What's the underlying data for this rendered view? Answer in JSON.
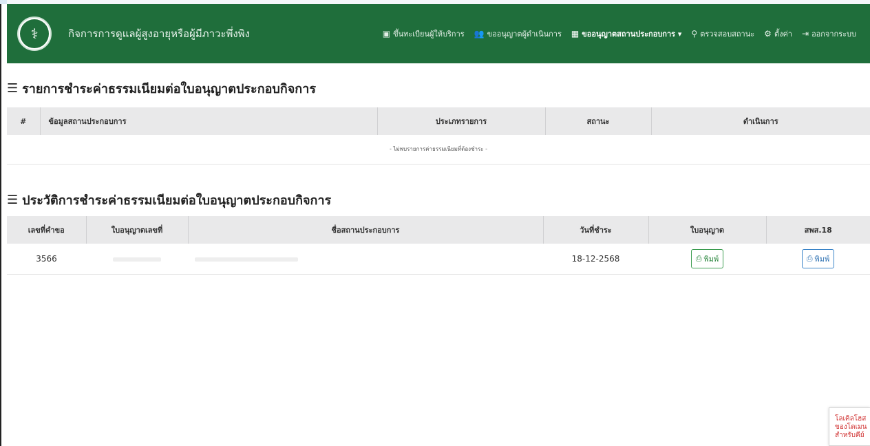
{
  "navbar": {
    "brand": "กิจการการดูแลผู้สูงอายุหรือผู้มีภาวะพึ่งพิง",
    "items": [
      {
        "icon": "▣",
        "label": "ขึ้นทะเบียนผู้ให้บริการ",
        "active": false
      },
      {
        "icon": "👥",
        "label": "ขออนุญาตผู้ดำเนินการ",
        "active": false
      },
      {
        "icon": "▦",
        "label": "ขออนุญาตสถานประกอบการ ▾",
        "active": true
      },
      {
        "icon": "⚲",
        "label": "ตรวจสอบสถานะ",
        "active": false
      },
      {
        "icon": "⚙",
        "label": "ตั้งค่า",
        "active": false
      },
      {
        "icon": "⇥",
        "label": "ออกจากระบบ",
        "active": false
      }
    ]
  },
  "pending": {
    "title": "รายการชำระค่าธรรมเนียมต่อใบอนุญาตประกอบกิจการ",
    "columns": [
      "#",
      "ข้อมูลสถานประกอบการ",
      "ประเภทรายการ",
      "สถานะ",
      "ดำเนินการ"
    ],
    "empty_message": "- ไม่พบรายการค่าธรรมเนียมที่ต้องชำระ -"
  },
  "history": {
    "title": "ประวัติการชำระค่าธรรมเนียมต่อใบอนุญาตประกอบกิจการ",
    "columns": [
      "เลขที่คำขอ",
      "ใบอนุญาตเลขที่",
      "ชื่อสถานประกอบการ",
      "วันที่ชำระ",
      "ใบอนุญาต",
      "สพส.18"
    ],
    "rows": [
      {
        "request_no": "3566",
        "payment_date": "18-12-2568",
        "license_btn": "พิมพ์",
        "form_btn": "พิมพ์"
      }
    ]
  },
  "recaptcha": {
    "line1": "โลเคิลโฮส",
    "line2": "ของโดเมน",
    "line3": "สำหรับคีย์"
  }
}
